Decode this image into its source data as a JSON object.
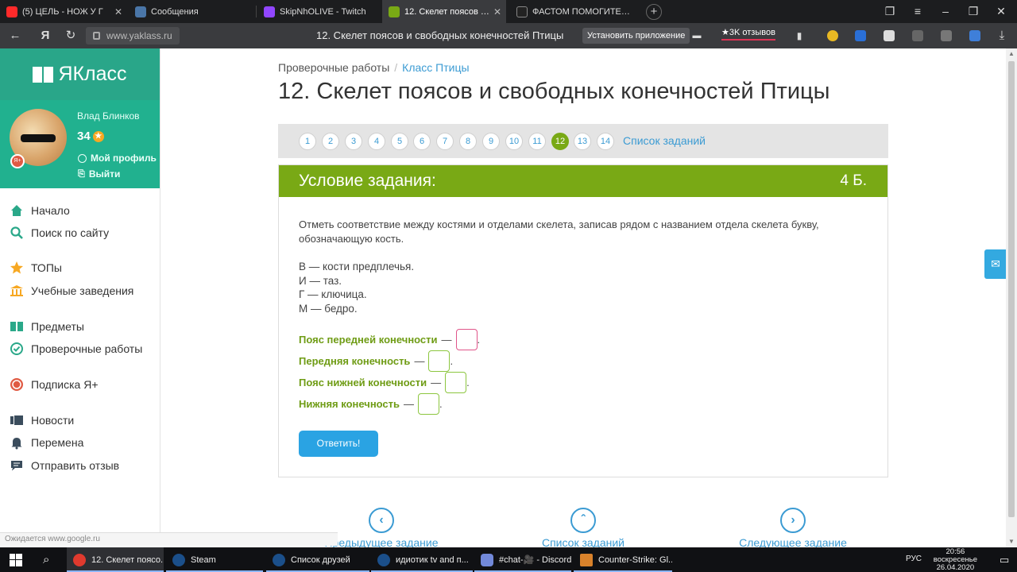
{
  "browser": {
    "tabs": [
      {
        "label": "(5) ЦЕЛЬ - НОЖ У Г",
        "color": "#ff2a2a"
      },
      {
        "label": "Сообщения",
        "color": "#4a76a8"
      },
      {
        "label": "SkipNhOLIVE - Twitch",
        "color": "#9146ff"
      },
      {
        "label": "12. Скелет поясов и своб",
        "color": "#79a915"
      },
      {
        "label": "ФАСТОМ ПОМОГИТЕ !!! Т",
        "color": "#222"
      }
    ],
    "url": "www.yaklass.ru",
    "page_title": "12. Скелет поясов и свободных конечностей Птицы",
    "install_label": "Установить приложение",
    "reviews_label": "★3K отзывов",
    "status_hint": "Ожидается www.google.ru"
  },
  "sidebar": {
    "brand": "ЯКласс",
    "user_name": "Влад Блинков",
    "points": "34",
    "profile_link": "Мой профиль",
    "logout_link": "Выйти",
    "items": [
      {
        "label": "Начало",
        "icon": "home-icon"
      },
      {
        "label": "Поиск по сайту",
        "icon": "search-icon"
      },
      {
        "label": "ТОПы",
        "icon": "star-icon"
      },
      {
        "label": "Учебные заведения",
        "icon": "institution-icon"
      },
      {
        "label": "Предметы",
        "icon": "books-icon"
      },
      {
        "label": "Проверочные работы",
        "icon": "check-circle-icon"
      },
      {
        "label": "Подписка Я+",
        "icon": "ya-plus-icon"
      },
      {
        "label": "Новости",
        "icon": "news-icon"
      },
      {
        "label": "Перемена",
        "icon": "bell-icon"
      },
      {
        "label": "Отправить отзыв",
        "icon": "feedback-icon"
      }
    ]
  },
  "main": {
    "breadcrumb_root": "Проверочные работы",
    "breadcrumb_link": "Класс Птицы",
    "title": "12. Скелет поясов и свободных конечностей Птицы",
    "pager": [
      "1",
      "2",
      "3",
      "4",
      "5",
      "6",
      "7",
      "8",
      "9",
      "10",
      "11",
      "12",
      "13",
      "14"
    ],
    "pager_current": "12",
    "task_list_label": "Список заданий",
    "task": {
      "heading": "Условие задания:",
      "points": "4 Б.",
      "instruction": "Отметь соответствие между костями и отделами скелета, записав рядом с названием отдела скелета букву, обозначающую кость.",
      "bones": [
        "В — кости предплечья.",
        "И — таз.",
        "Г — ключица.",
        "М — бедро."
      ],
      "answers": [
        {
          "label": "Пояс передней конечности",
          "value": ""
        },
        {
          "label": "Передняя конечность",
          "value": ""
        },
        {
          "label": "Пояс нижней конечности",
          "value": ""
        },
        {
          "label": "Нижняя конечность",
          "value": ""
        }
      ],
      "dash": "—",
      "period": ".",
      "submit_label": "Ответить!"
    },
    "nav": {
      "prev": "Предыдущее задание",
      "list": "Список заданий",
      "next": "Следующее задание"
    }
  },
  "taskbar": {
    "items": [
      {
        "label": "12. Скелет поясо...",
        "color": "#e03a2e"
      },
      {
        "label": "Steam",
        "color": "#1b4f8a"
      },
      {
        "label": "Список друзей",
        "color": "#1b4f8a"
      },
      {
        "label": "идиотик tv and п...",
        "color": "#1b4f8a"
      },
      {
        "label": "#chat-🎥 - Discord",
        "color": "#7289da"
      },
      {
        "label": "Counter-Strike: Gl...",
        "color": "#d9822b"
      }
    ],
    "lang": "РУС",
    "time": "20:56",
    "day": "воскресенье",
    "date": "26.04.2020"
  }
}
